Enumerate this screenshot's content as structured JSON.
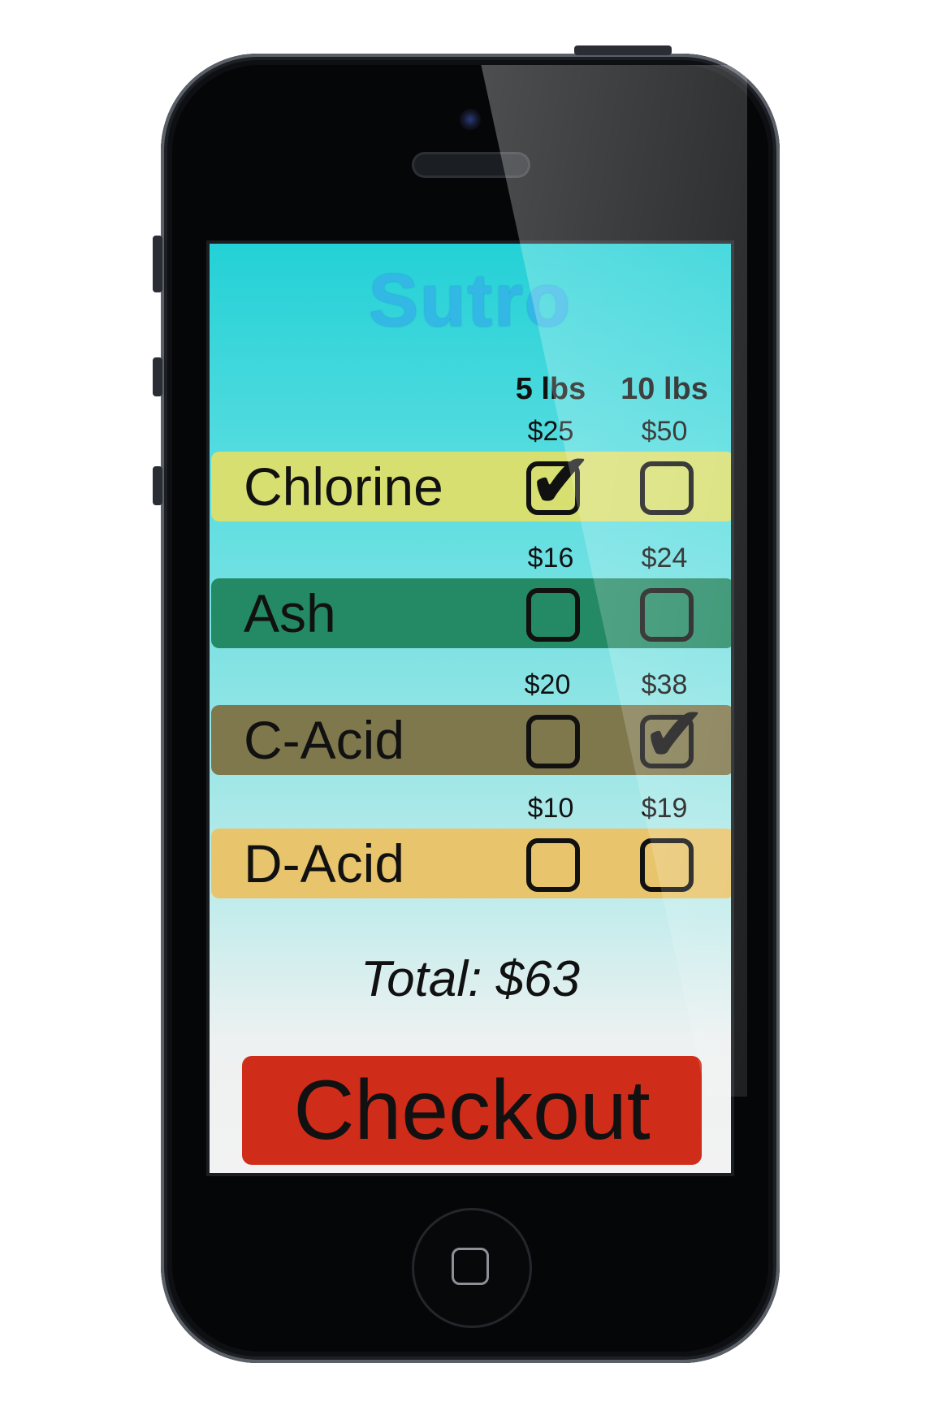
{
  "app": {
    "name": "Sutro"
  },
  "columns": [
    {
      "label": "5 lbs"
    },
    {
      "label": "10 lbs"
    }
  ],
  "products": [
    {
      "name": "Chlorine",
      "color": "#d7df70",
      "prices": [
        "$25",
        "$50"
      ],
      "checked": [
        true,
        false
      ]
    },
    {
      "name": "Ash",
      "color": "#248a66",
      "prices": [
        "$16",
        "$24"
      ],
      "checked": [
        false,
        false
      ]
    },
    {
      "name": "C-Acid",
      "color": "#80784d",
      "prices": [
        "$20",
        "$38"
      ],
      "checked": [
        false,
        true
      ]
    },
    {
      "name": "D-Acid",
      "color": "#e8c56d",
      "prices": [
        "$10",
        "$19"
      ],
      "checked": [
        false,
        false
      ]
    }
  ],
  "checkmark_glyph": "✔",
  "total": {
    "text": "Total: $63"
  },
  "checkout": {
    "label": "Checkout",
    "color": "#d02c1a"
  }
}
